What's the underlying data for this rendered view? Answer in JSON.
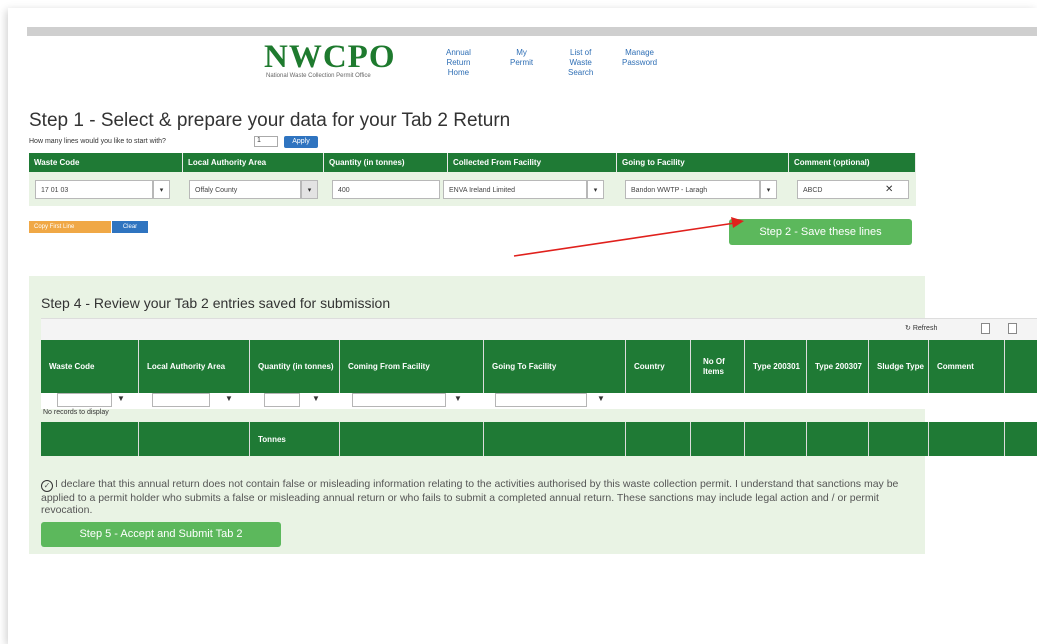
{
  "header": {
    "logo_text": "NWCPO",
    "logo_subtitle": "National Waste Collection Permit Office",
    "nav": [
      {
        "lines": [
          "Annual",
          "Return",
          "Home"
        ]
      },
      {
        "lines": [
          "My",
          "Permit"
        ]
      },
      {
        "lines": [
          "List of",
          "Waste",
          "Search"
        ]
      },
      {
        "lines": [
          "Manage",
          "Password"
        ]
      }
    ]
  },
  "step1": {
    "title": "Step 1 -  Select & prepare your data for your Tab 2 Return",
    "lines_question": "How many lines would you like to start with?",
    "lines_value": "1",
    "apply_label": "Apply",
    "columns": [
      "Waste Code",
      "Local Authority Area",
      "Quantity (in tonnes)",
      "Collected From Facility",
      "Going to Facility",
      "Comment (optional)"
    ],
    "row": {
      "waste_code": "17 01 03",
      "local_authority": "Offaly County",
      "quantity": "400",
      "collected_from": "ENVA Ireland Limited",
      "going_to": "Bandon WWTP - Laragh",
      "comment": "ABCD"
    },
    "copy_first_line_label": "Copy First Line",
    "clear_label": "Clear",
    "step2_label": "Step 2 - Save these lines"
  },
  "step4": {
    "title": "Step 4 - Review your Tab 2 entries saved for submission",
    "refresh_label": "Refresh",
    "columns": [
      "Waste Code",
      "Local Authority Area",
      "Quantity (in tonnes)",
      "Coming From Facility",
      "Going To Facility",
      "Country",
      "No Of Items",
      "Type 200301",
      "Type 200307",
      "Sludge Type",
      "Comment"
    ],
    "no_records": "No records to display",
    "footer_quantity": "Tonnes"
  },
  "declaration": {
    "text": "I declare that this annual return does not contain false or misleading information relating to the activities authorised by this waste collection permit. I understand that sanctions may be applied to a permit holder who submits a false or misleading annual return or who fails to submit a completed annual return. These sanctions may include legal action and / or permit revocation.",
    "step5_label": "Step 5 - Accept and Submit Tab 2"
  },
  "icons": {
    "dropdown": "chevron-down-icon",
    "filter": "funnel-icon",
    "clear": "close-icon",
    "check": "check-circle-icon",
    "refresh": "refresh-icon"
  },
  "colors": {
    "header_green": "#1f7a35",
    "panel_green": "#e9f3e4",
    "button_green": "#5cb85c",
    "button_blue": "#2f74c0",
    "button_orange": "#f0a846",
    "annotation_arrow": "#e0201c"
  }
}
